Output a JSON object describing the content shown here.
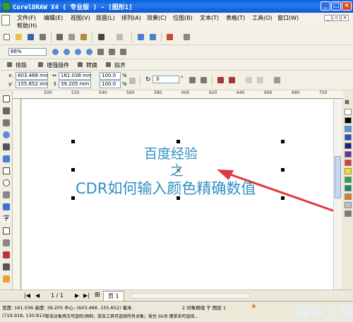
{
  "window": {
    "title": "CorelDRAW X4 ( 专业版 ) - [图形1]"
  },
  "menu": {
    "items": [
      "文件(F)",
      "编辑(E)",
      "视图(V)",
      "版面(L)",
      "排列(A)",
      "效果(C)",
      "位图(B)",
      "文本(T)",
      "表格(T)",
      "工具(O)",
      "窗口(W)",
      "帮助(H)"
    ]
  },
  "zoom_toolbar": {
    "zoom_value": "86%"
  },
  "property_bar_tabs": [
    "排版",
    "增强插件",
    "转换",
    "拟齐"
  ],
  "property_bar": {
    "x_label": "x:",
    "x_value": "603.468 mm",
    "y_label": "y:",
    "y_value": "155.652 mm",
    "width_value": "161.036 mm",
    "height_value": "39.205 mm",
    "scale_x": "100.0",
    "scale_y": "100.0",
    "percent": "%",
    "rotation": ".0",
    "degree": "°"
  },
  "ruler": {
    "ticks": [
      "500",
      "520",
      "540",
      "560",
      "580",
      "600",
      "620",
      "640",
      "660",
      "680",
      "700"
    ]
  },
  "canvas": {
    "line1": "百度经验",
    "line2": "之",
    "line3": "CDR如何输入颜色精确数值"
  },
  "page_nav": {
    "page_counter": "1 / 1",
    "page_tab": "页 1"
  },
  "status": {
    "dimensions": "宽度: 161.036 高度: 39.205 中心: (603.468, 155.652) 毫米",
    "selection": "2 对象群组 于 图层 1",
    "cursor": "(719.918, 130.813)",
    "hint": "单击对象两次可旋转/倾斜；双击工具可选择所有对象；按住 Shift 键单击可选择..."
  },
  "watermark": {
    "site": "jb51.net",
    "brand": "脚本之家"
  },
  "colors": {
    "title_bar": "#1c6fe0",
    "art_text": "#2f8fc4",
    "arrow": "#e0383f",
    "palette": [
      "#ffffff",
      "#000000",
      "#4d9be8",
      "#2b4ec6",
      "#1e1e8a",
      "#6b2fa8",
      "#e0383f",
      "#f3e21a",
      "#2ea34a",
      "#148f6b",
      "#e07a1f",
      "#c2c2c2",
      "#7a7a7a"
    ]
  }
}
